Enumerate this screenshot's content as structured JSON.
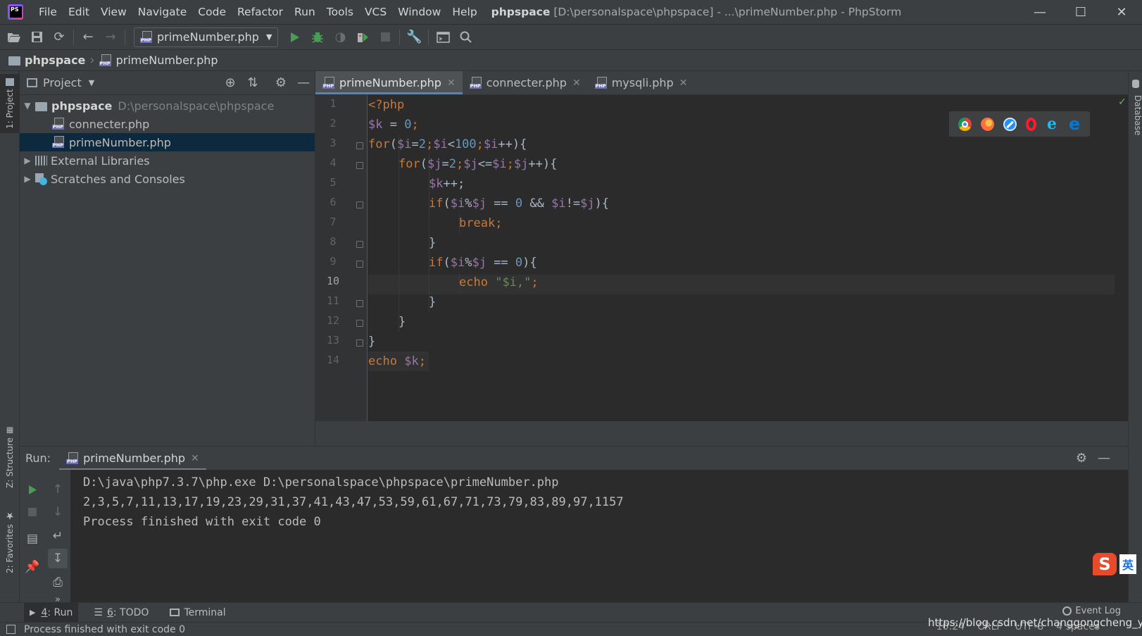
{
  "menu": {
    "items": [
      "File",
      "Edit",
      "View",
      "Navigate",
      "Code",
      "Refactor",
      "Run",
      "Tools",
      "VCS",
      "Window",
      "Help"
    ],
    "title_project": "phpspace",
    "title_rest": "[D:\\personalspace\\phpspace] - ...\\primeNumber.php - PhpStorm"
  },
  "toolbar": {
    "run_config": "primeNumber.php"
  },
  "breadcrumb": {
    "root": "phpspace",
    "file": "primeNumber.php"
  },
  "stripes": {
    "project": "1: Project",
    "structure": "Z: Structure",
    "favorites": "2: Favorites",
    "database": "Database"
  },
  "project": {
    "title": "Project",
    "root_name": "phpspace",
    "root_path": "D:\\personalspace\\phpspace",
    "files": [
      "connecter.php",
      "primeNumber.php"
    ],
    "external_libraries": "External Libraries",
    "scratches": "Scratches and Consoles"
  },
  "editor": {
    "tabs": [
      "primeNumber.php",
      "connecter.php",
      "mysqli.php"
    ],
    "line_numbers": [
      "1",
      "2",
      "3",
      "4",
      "5",
      "6",
      "7",
      "8",
      "9",
      "10",
      "11",
      "12",
      "13",
      "14"
    ],
    "current_line": "10",
    "code": {
      "l1": "<?php",
      "l2": {
        "var": "$k",
        "op": " = ",
        "num": "0",
        "end": ";"
      },
      "l3": {
        "kw": "for",
        "a": "(",
        "v1": "$i",
        "a2": "=",
        "n1": "2",
        "a3": ";",
        "v2": "$i",
        "a4": "<",
        "n2": "100",
        "a5": ";",
        "v3": "$i",
        "a6": "++){"
      },
      "l4": {
        "kw": "for",
        "a": "(",
        "v1": "$j",
        "a2": "=",
        "n1": "2",
        "a3": ";",
        "v2": "$j",
        "a4": "<=",
        "v3": "$i",
        "a5": ";",
        "v4": "$j",
        "a6": "++){"
      },
      "l5": {
        "var": "$k",
        "rest": "++;"
      },
      "l6": {
        "kw": "if",
        "a": "(",
        "v1": "$i",
        "a2": "%",
        "v2": "$j",
        "a3": " == ",
        "n1": "0",
        "a4": " && ",
        "v3": "$i",
        "a5": "!=",
        "v4": "$j",
        "a6": "){"
      },
      "l7": {
        "kw": "break",
        "end": ";"
      },
      "l8": "}",
      "l9": {
        "kw": "if",
        "a": "(",
        "v1": "$i",
        "a2": "%",
        "v2": "$j",
        "a3": " == ",
        "n1": "0",
        "a4": "){"
      },
      "l10": {
        "kw": "echo",
        "sp": " ",
        "str": "\"$i,\"",
        "end": ";"
      },
      "l11": "}",
      "l12": "}",
      "l13": "}",
      "l14": {
        "kw": "echo",
        "sp": " ",
        "var": "$k",
        "end": ";"
      }
    }
  },
  "run": {
    "label": "Run:",
    "tab": "primeNumber.php",
    "output": [
      "D:\\java\\php7.3.7\\php.exe D:\\personalspace\\phpspace\\primeNumber.php",
      "2,3,5,7,11,13,17,19,23,29,31,37,41,43,47,53,59,61,67,71,73,79,83,89,97,1157",
      "Process finished with exit code 0"
    ]
  },
  "ime": {
    "letter": "S",
    "text": "英"
  },
  "bottom_tabs": {
    "run_num": "4",
    "run": ": Run",
    "todo_num": "6",
    "todo": ": TODO",
    "terminal": "Terminal",
    "event_log": "Event Log"
  },
  "status": {
    "message": "Process finished with exit code 0",
    "position": "10:24",
    "line_sep": "CRLF",
    "encoding": "UTF-8",
    "indent": "4 spaces",
    "watermark": "https://blog.csdn.net/changgongcheng_yg"
  },
  "colors": {
    "keyword": "#cc7832",
    "variable": "#9876aa",
    "number": "#6897bb",
    "string": "#6a8759",
    "selection": "#0d293e",
    "run_green": "#499c54"
  },
  "icons": [
    "open-folder-icon",
    "save-icon",
    "sync-icon",
    "back-icon",
    "forward-icon",
    "run-icon",
    "debug-icon",
    "coverage-icon",
    "profile-icon",
    "stop-icon",
    "wrench-icon",
    "terminal-icon",
    "search-icon",
    "chrome-icon",
    "firefox-icon",
    "safari-icon",
    "opera-icon",
    "ie-icon",
    "edge-icon"
  ]
}
